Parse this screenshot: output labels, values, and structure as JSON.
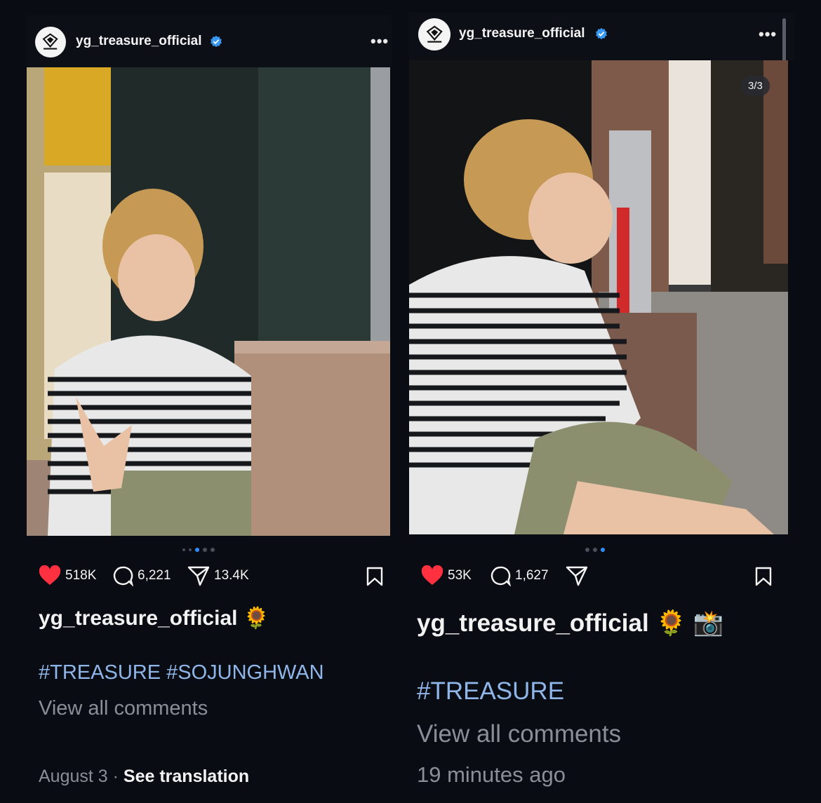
{
  "left_post": {
    "username": "yg_treasure_official",
    "carousel": {
      "count": 5,
      "active_index": 2
    },
    "likes": "518K",
    "comments": "6,221",
    "shares": "13.4K",
    "caption_user": "yg_treasure_official",
    "caption_emoji": "🌻",
    "hashtags": "#TREASURE #SOJUNGHWAN",
    "view_all": "View all comments",
    "date": "August 3",
    "date_sep": "·",
    "see_translation": "See translation"
  },
  "right_post": {
    "username": "yg_treasure_official",
    "counter": "3/3",
    "carousel": {
      "count": 3,
      "active_index": 2
    },
    "likes": "53K",
    "comments": "1,627",
    "caption_user": "yg_treasure_official",
    "caption_emoji": "🌻 📸",
    "hashtags": "#TREASURE",
    "view_all": "View all comments",
    "time": "19 minutes ago"
  },
  "colors": {
    "background": "#0a0c13",
    "verified": "#3897f0",
    "heart": "#ff3040",
    "hashtag": "#8fb6e8",
    "muted": "#8b8e96",
    "active_dot": "#2f8fff"
  },
  "icons": [
    "verified-badge-icon",
    "more-icon",
    "heart-icon",
    "comment-icon",
    "share-icon",
    "bookmark-icon",
    "treasure-logo-icon"
  ]
}
